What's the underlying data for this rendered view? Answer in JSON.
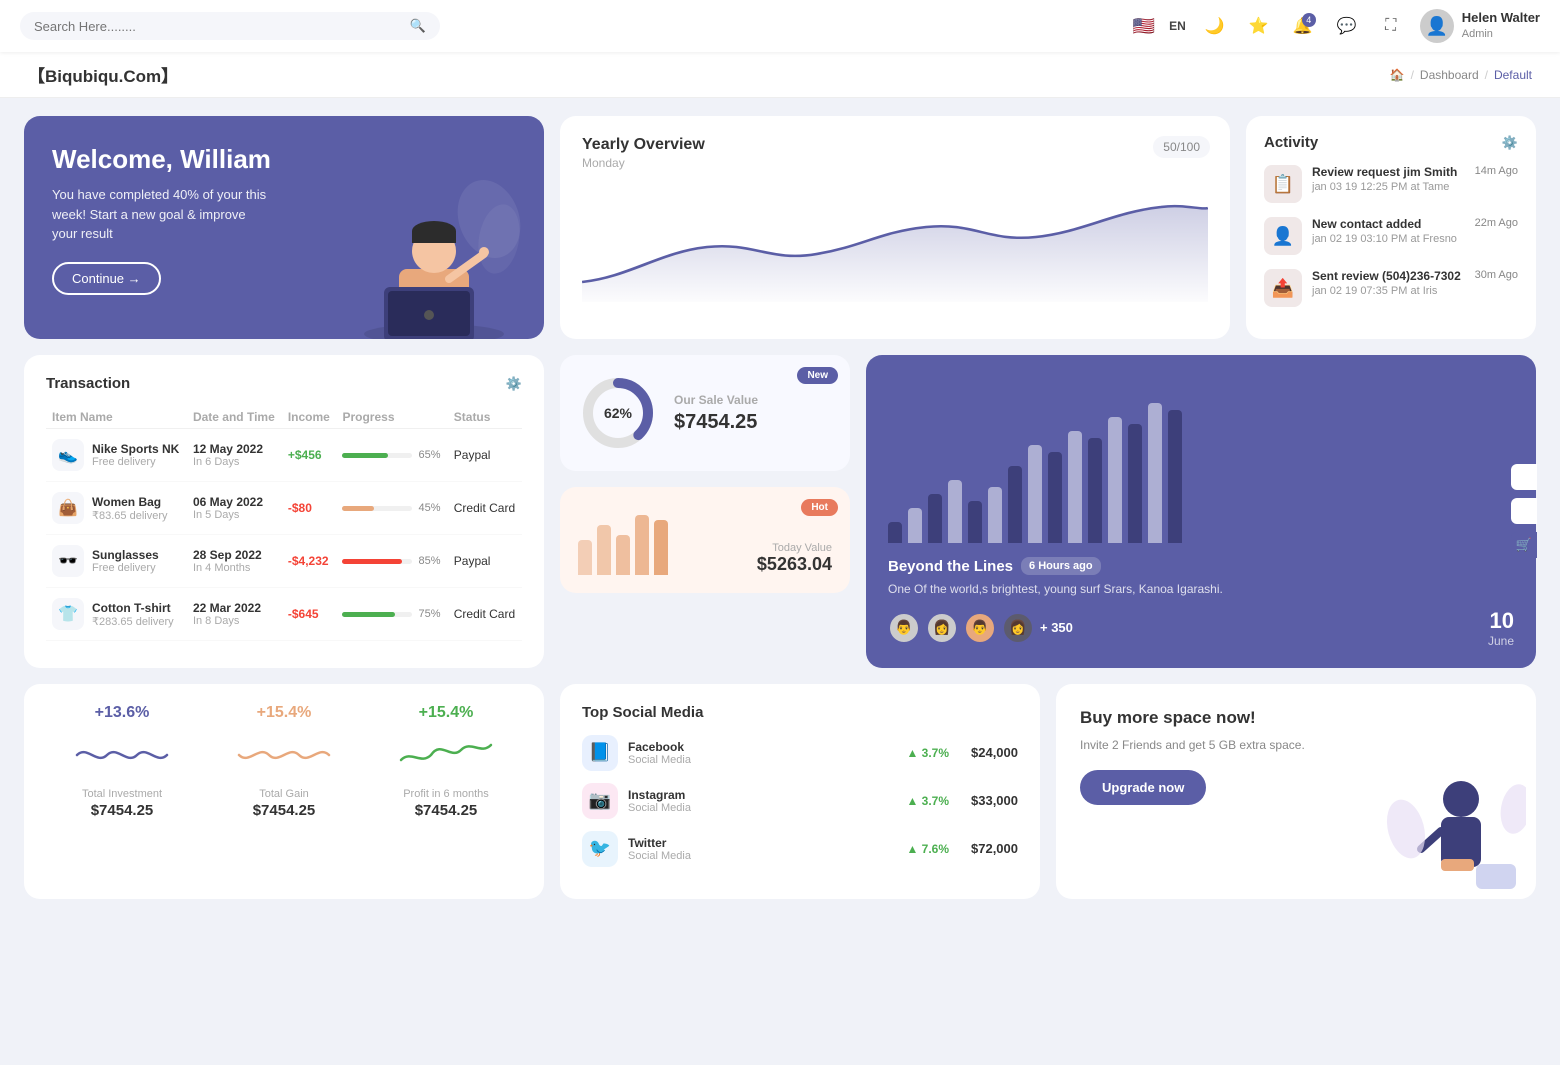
{
  "topnav": {
    "search_placeholder": "Search Here........",
    "lang": "EN",
    "notification_count": "4",
    "user": {
      "name": "Helen Walter",
      "role": "Admin"
    }
  },
  "breadcrumb": {
    "brand": "【Biqubiqu.Com】",
    "home_icon": "🏠",
    "items": [
      "Dashboard",
      "Default"
    ]
  },
  "welcome": {
    "title": "Welcome, William",
    "subtitle": "You have completed 40% of your this week! Start a new goal & improve your result",
    "button": "Continue →"
  },
  "yearly_overview": {
    "title": "Yearly Overview",
    "subtitle": "Monday",
    "badge": "50/100"
  },
  "activity": {
    "title": "Activity",
    "items": [
      {
        "title": "Review request jim Smith",
        "desc": "jan 03 19 12:25 PM at Tame",
        "time": "14m Ago"
      },
      {
        "title": "New contact added",
        "desc": "jan 02 19 03:10 PM at Fresno",
        "time": "22m Ago"
      },
      {
        "title": "Sent review (504)236-7302",
        "desc": "jan 02 19 07:35 PM at Iris",
        "time": "30m Ago"
      }
    ]
  },
  "transaction": {
    "title": "Transaction",
    "columns": [
      "Item Name",
      "Date and Time",
      "Income",
      "Progress",
      "Status"
    ],
    "rows": [
      {
        "icon": "👟",
        "name": "Nike Sports NK",
        "sub": "Free delivery",
        "date": "12 May 2022",
        "days": "In 6 Days",
        "income": "+$456",
        "income_type": "pos",
        "progress": 65,
        "progress_color": "#4caf50",
        "status": "Paypal"
      },
      {
        "icon": "👜",
        "name": "Women Bag",
        "sub": "₹83.65 delivery",
        "date": "06 May 2022",
        "days": "In 5 Days",
        "income": "-$80",
        "income_type": "neg",
        "progress": 45,
        "progress_color": "#e8a87c",
        "status": "Credit Card"
      },
      {
        "icon": "🕶️",
        "name": "Sunglasses",
        "sub": "Free delivery",
        "date": "28 Sep 2022",
        "days": "In 4 Months",
        "income": "-$4,232",
        "income_type": "neg",
        "progress": 85,
        "progress_color": "#f44336",
        "status": "Paypal"
      },
      {
        "icon": "👕",
        "name": "Cotton T-shirt",
        "sub": "₹283.65 delivery",
        "date": "22 Mar 2022",
        "days": "In 8 Days",
        "income": "-$645",
        "income_type": "neg",
        "progress": 75,
        "progress_color": "#4caf50",
        "status": "Credit Card"
      }
    ]
  },
  "sale_new": {
    "badge": "New",
    "label": "Our Sale Value",
    "value": "$7454.25",
    "percent": "62%",
    "donut_pct": 62
  },
  "sale_hot": {
    "badge": "Hot",
    "label": "Today Value",
    "value": "$5263.04"
  },
  "bar_chart": {
    "title": "Beyond the Lines",
    "time_ago": "6 Hours ago",
    "desc": "One Of the world,s brightest, young surf Srars, Kanoa Igarashi.",
    "plus_count": "+ 350",
    "date_day": "10",
    "date_month": "June",
    "bars": [
      3,
      5,
      7,
      9,
      6,
      8,
      11,
      14,
      13,
      16,
      15,
      18,
      17,
      20,
      19
    ]
  },
  "mini_stats": [
    {
      "pct": "+13.6%",
      "color": "purple",
      "name": "Total Investment",
      "value": "$7454.25"
    },
    {
      "pct": "+15.4%",
      "color": "orange",
      "name": "Total Gain",
      "value": "$7454.25"
    },
    {
      "pct": "+15.4%",
      "color": "green",
      "name": "Profit in 6 months",
      "value": "$7454.25"
    }
  ],
  "social_media": {
    "title": "Top Social Media",
    "items": [
      {
        "icon": "📘",
        "bg": "fb-bg",
        "name": "Facebook",
        "sub": "Social Media",
        "pct": "3.7%",
        "amount": "$24,000"
      },
      {
        "icon": "📷",
        "bg": "ig-bg",
        "name": "Instagram",
        "sub": "Social Media",
        "pct": "3.7%",
        "amount": "$33,000"
      },
      {
        "icon": "🐦",
        "bg": "tw-bg",
        "name": "Twitter",
        "sub": "Social Media",
        "pct": "7.6%",
        "amount": "$72,000"
      }
    ]
  },
  "upgrade": {
    "title": "Buy more space now!",
    "desc": "Invite 2 Friends and get 5 GB extra space.",
    "button": "Upgrade now"
  }
}
